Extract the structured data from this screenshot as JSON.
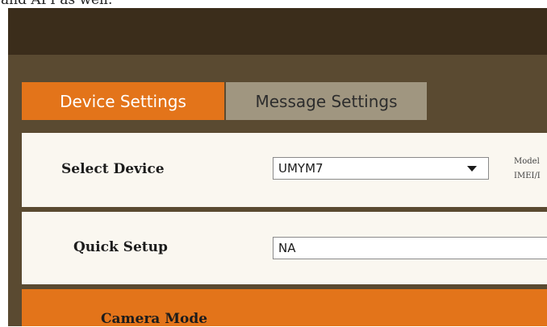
{
  "page": {
    "top_text": "and API as well."
  },
  "tabs": {
    "device_settings": "Device Settings",
    "message_settings": "Message Settings"
  },
  "select_device": {
    "label": "Select Device",
    "value": "UMYM7",
    "info_line1": "Model",
    "info_line2": "IMEI/I"
  },
  "quick_setup": {
    "label": "Quick Setup",
    "value": "NA"
  },
  "camera_mode": {
    "label": "Camera Mode"
  },
  "colors": {
    "accent": "#e3741a",
    "tab_inactive": "#a09680",
    "panel": "#5a4a31",
    "header": "#3b2d1b",
    "row_background": "#faf7f0"
  }
}
